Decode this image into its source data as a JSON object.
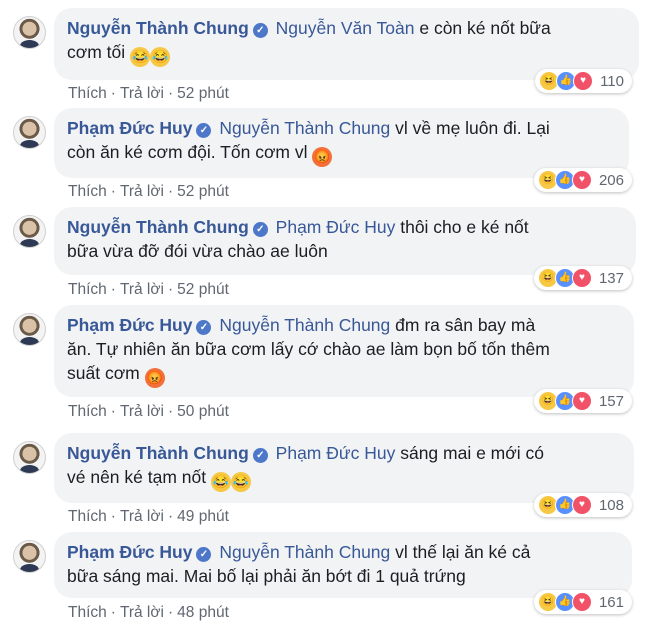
{
  "comments": [
    {
      "author": "Nguyễn Thành Chung",
      "mention": "Nguyễn Văn Toàn",
      "text_line1": "e còn ké nốt bữa",
      "text_line2": "cơm tối",
      "emoji": [
        "😂",
        "😂"
      ],
      "reaction_count": "110",
      "like_label": "Thích",
      "reply_label": "Trả lời",
      "time": "52 phút"
    },
    {
      "author": "Phạm Đức Huy",
      "mention": "Nguyễn Thành Chung",
      "text_line1": "vl về mẹ luôn đi. Lại",
      "text_line2": "còn ăn ké cơm đội. Tốn cơm vl",
      "emoji": [
        "😡"
      ],
      "reaction_count": "206",
      "like_label": "Thích",
      "reply_label": "Trả lời",
      "time": "52 phút"
    },
    {
      "author": "Nguyễn Thành Chung",
      "mention": "Phạm Đức Huy",
      "text_line1": "thôi cho e ké nốt",
      "text_line2": "bữa vừa đỡ đói vừa chào ae luôn",
      "emoji": [],
      "reaction_count": "137",
      "like_label": "Thích",
      "reply_label": "Trả lời",
      "time": "52 phút"
    },
    {
      "author": "Phạm Đức Huy",
      "mention": "Nguyễn Thành Chung",
      "text_line1": "đm ra sân bay mà",
      "text_line2": "ăn. Tự nhiên ăn bữa cơm lấy cớ chào ae làm bọn bố tốn thêm",
      "text_line3": "suất cơm",
      "emoji": [
        "😡"
      ],
      "reaction_count": "157",
      "like_label": "Thích",
      "reply_label": "Trả lời",
      "time": "50 phút"
    },
    {
      "author": "Nguyễn Thành Chung",
      "mention": "Phạm Đức Huy",
      "text_line1": "sáng mai e mới có",
      "text_line2": "vé nên ké tạm nốt",
      "emoji": [
        "😂",
        "😂"
      ],
      "reaction_count": "108",
      "like_label": "Thích",
      "reply_label": "Trả lời",
      "time": "49 phút"
    },
    {
      "author": "Phạm Đức Huy",
      "mention": "Nguyễn Thành Chung",
      "text_line1": "vl thế lại ăn ké cả",
      "text_line2": "bữa sáng mai. Mai bố lại phải ăn bớt đi 1 quả trứng",
      "emoji": [],
      "reaction_count": "161",
      "like_label": "Thích",
      "reply_label": "Trả lời",
      "time": "48 phút"
    }
  ],
  "reaction_icons": [
    "haha-icon",
    "like-icon",
    "love-icon"
  ],
  "colors": {
    "author": "#385898",
    "bubble": "#f2f3f5",
    "meta": "#606770"
  }
}
